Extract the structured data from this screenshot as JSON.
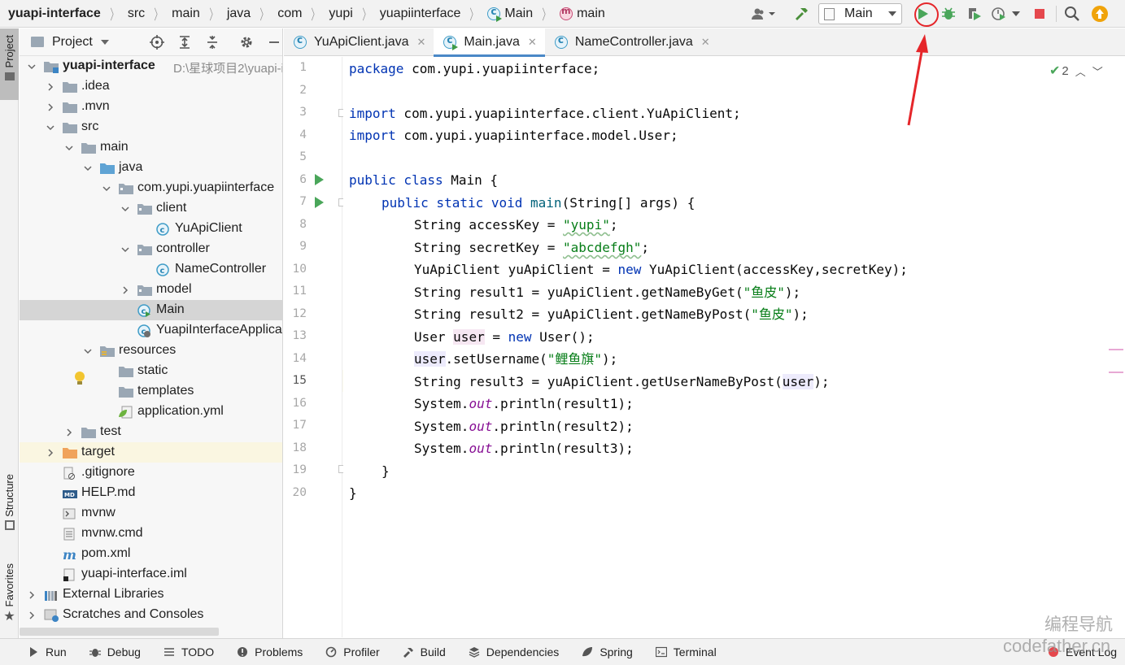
{
  "navbar": {
    "breadcrumbs": [
      "yuapi-interface",
      "src",
      "main",
      "java",
      "com",
      "yupi",
      "yuapiinterface",
      "Main",
      "main"
    ],
    "run_config": "Main"
  },
  "left_stripe": {
    "project": "Project",
    "structure": "Structure",
    "favorites": "Favorites"
  },
  "project_panel": {
    "title": "Project",
    "tree": [
      {
        "label": "yuapi-interface",
        "hint": "D:\\星球项目2\\yuapi-in",
        "depth": 0,
        "state": "open",
        "icon": "module-folder-icon",
        "bold": true
      },
      {
        "label": ".idea",
        "depth": 1,
        "state": "closed",
        "icon": "folder-icon"
      },
      {
        "label": ".mvn",
        "depth": 1,
        "state": "closed",
        "icon": "folder-icon"
      },
      {
        "label": "src",
        "depth": 1,
        "state": "open",
        "icon": "folder-icon"
      },
      {
        "label": "main",
        "depth": 2,
        "state": "open",
        "icon": "folder-icon"
      },
      {
        "label": "java",
        "depth": 3,
        "state": "open",
        "icon": "source-folder-icon"
      },
      {
        "label": "com.yupi.yuapiinterface",
        "depth": 4,
        "state": "open",
        "icon": "package-icon"
      },
      {
        "label": "client",
        "depth": 5,
        "state": "open",
        "icon": "package-icon"
      },
      {
        "label": "YuApiClient",
        "depth": 6,
        "state": "none",
        "icon": "class-icon"
      },
      {
        "label": "controller",
        "depth": 5,
        "state": "open",
        "icon": "package-icon"
      },
      {
        "label": "NameController",
        "depth": 6,
        "state": "none",
        "icon": "class-icon"
      },
      {
        "label": "model",
        "depth": 5,
        "state": "closed",
        "icon": "package-icon"
      },
      {
        "label": "Main",
        "depth": 5,
        "state": "none",
        "icon": "runnable-class-icon",
        "selected": true
      },
      {
        "label": "YuapiInterfaceApplica",
        "depth": 5,
        "state": "none",
        "icon": "spring-boot-class-icon"
      },
      {
        "label": "resources",
        "depth": 3,
        "state": "open",
        "icon": "resources-folder-icon"
      },
      {
        "label": "static",
        "depth": 4,
        "state": "none",
        "icon": "folder-icon"
      },
      {
        "label": "templates",
        "depth": 4,
        "state": "none",
        "icon": "folder-icon"
      },
      {
        "label": "application.yml",
        "depth": 4,
        "state": "none",
        "icon": "spring-yaml-icon"
      },
      {
        "label": "test",
        "depth": 2,
        "state": "closed",
        "icon": "folder-icon"
      },
      {
        "label": "target",
        "depth": 1,
        "state": "closed",
        "icon": "excluded-folder-icon",
        "excluded": true
      },
      {
        "label": ".gitignore",
        "depth": 1,
        "state": "none",
        "icon": "gitignore-file-icon"
      },
      {
        "label": "HELP.md",
        "depth": 1,
        "state": "none",
        "icon": "markdown-file-icon"
      },
      {
        "label": "mvnw",
        "depth": 1,
        "state": "none",
        "icon": "script-file-icon"
      },
      {
        "label": "mvnw.cmd",
        "depth": 1,
        "state": "none",
        "icon": "text-file-icon"
      },
      {
        "label": "pom.xml",
        "depth": 1,
        "state": "none",
        "icon": "maven-icon"
      },
      {
        "label": "yuapi-interface.iml",
        "depth": 1,
        "state": "none",
        "icon": "iml-file-icon"
      },
      {
        "label": "External Libraries",
        "depth": 0,
        "state": "closed",
        "icon": "libraries-icon"
      },
      {
        "label": "Scratches and Consoles",
        "depth": 0,
        "state": "closed",
        "icon": "scratches-icon"
      }
    ]
  },
  "editor": {
    "tabs": [
      {
        "label": "YuApiClient.java",
        "active": false
      },
      {
        "label": "Main.java",
        "active": true
      },
      {
        "label": "NameController.java",
        "active": false
      }
    ],
    "inspection_count": "2",
    "line_numbers": [
      "1",
      "2",
      "3",
      "4",
      "5",
      "6",
      "7",
      "8",
      "9",
      "10",
      "11",
      "12",
      "13",
      "14",
      "15",
      "16",
      "17",
      "18",
      "19",
      "20"
    ],
    "code": {
      "l1_kw": "package",
      "l1_rest": " com.yupi.yuapiinterface;",
      "l3_kw": "import",
      "l3_rest": " com.yupi.yuapiinterface.client.YuApiClient;",
      "l4_kw": "import",
      "l4_rest": " com.yupi.yuapiinterface.model.User;",
      "l6_kw": "public class",
      "l6_rest": " Main {",
      "l7_kw": "public static void",
      "l7_mth": " main",
      "l7_rest": "(String[] args) {",
      "l8_a": "String accessKey = ",
      "l8_str": "\"yupi\"",
      "l8_b": ";",
      "l9_a": "String secretKey = ",
      "l9_str": "\"abcdefgh\"",
      "l9_b": ";",
      "l10_a": "YuApiClient yuApiClient = ",
      "l10_kw": "new",
      "l10_b": " YuApiClient(accessKey,secretKey);",
      "l11_a": "String result1 = yuApiClient.getNameByGet(",
      "l11_str": "\"鱼皮\"",
      "l11_b": ");",
      "l12_a": "String result2 = yuApiClient.getNameByPost(",
      "l12_str": "\"鱼皮\"",
      "l12_b": ");",
      "l13_a": "User ",
      "l13_var": "user",
      "l13_b": " = ",
      "l13_kw": "new",
      "l13_c": " User();",
      "l14_var": "user",
      "l14_a": ".setUsername(",
      "l14_str": "\"鲤鱼旗\"",
      "l14_b": ");",
      "l15_a": "String result3 = yuApiClient.getUserNameByPost(",
      "l15_var": "user",
      "l15_b": ");",
      "l16_a": "System.",
      "l16_fld": "out",
      "l16_b": ".println(result1);",
      "l17_a": "System.",
      "l17_fld": "out",
      "l17_b": ".println(result2);",
      "l18_a": "System.",
      "l18_fld": "out",
      "l18_b": ".println(result3);",
      "l19": "}",
      "l20": "}"
    }
  },
  "bottom_bar": [
    "Run",
    "Debug",
    "TODO",
    "Problems",
    "Profiler",
    "Build",
    "Dependencies",
    "Spring",
    "Terminal",
    "Event Log"
  ],
  "watermark": {
    "line1": "编程导航",
    "line2": "codefather.cn"
  },
  "colors": {
    "annotation_red": "#e5262a",
    "run_green": "#4aa65a",
    "keyword": "#0033b3",
    "string": "#067d17"
  }
}
